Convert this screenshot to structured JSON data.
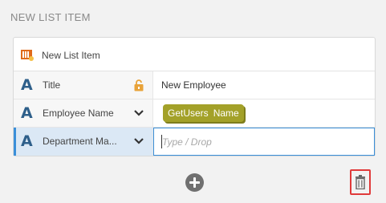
{
  "section": {
    "title": "NEW LIST ITEM"
  },
  "card": {
    "header_label": "New List Item",
    "header_icon": "sharepoint-list-icon"
  },
  "fields": [
    {
      "label": "Title",
      "value": "New Employee",
      "icon": "text-type-icon",
      "control": "lock-icon"
    },
    {
      "label": "Employee Name",
      "token": {
        "source": "GetUsers",
        "field": "Name"
      },
      "icon": "text-type-icon",
      "control": "chevron-down-icon"
    },
    {
      "label": "Department Ma...",
      "placeholder": "Type / Drop",
      "icon": "text-type-icon",
      "control": "chevron-down-icon"
    }
  ],
  "colors": {
    "accent": "#3a8fd9",
    "token": "#a3a129",
    "delete_highlight": "#e03a3a",
    "type_icon": "#2e5f8a",
    "lock": "#e8a33a"
  }
}
